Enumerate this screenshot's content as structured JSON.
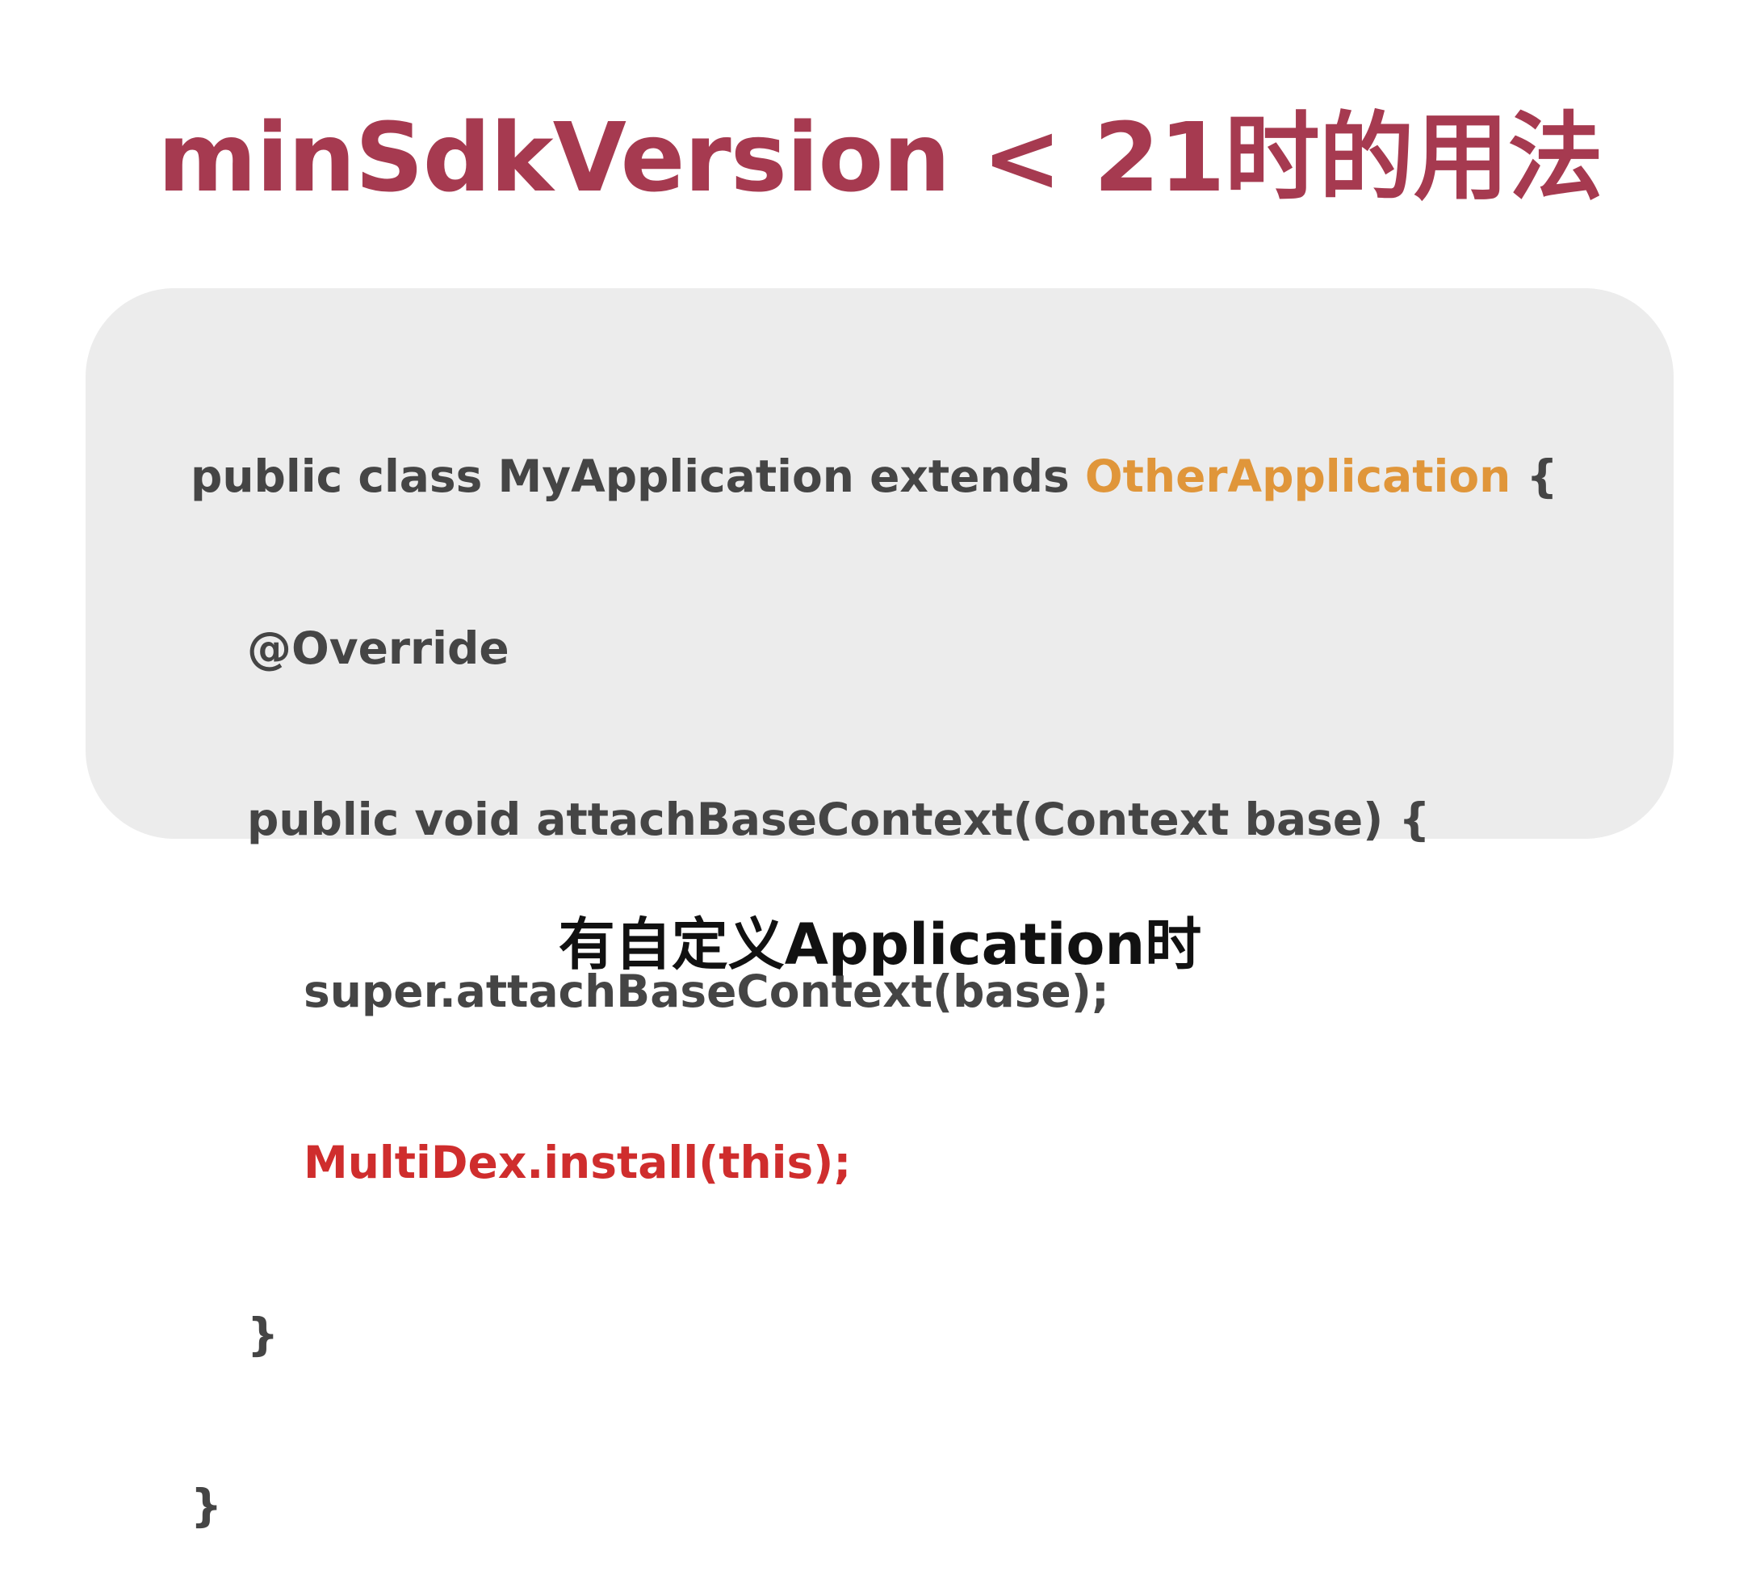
{
  "title": "minSdkVersion < 21时的用法",
  "code": {
    "line1_prefix": "public class MyApplication extends ",
    "line1_parent": "OtherApplication",
    "line1_suffix": " {",
    "line2": "@Override",
    "line3": "public void attachBaseContext(Context base) {",
    "line4": "super.attachBaseContext(base);",
    "line5": "MultiDex.install(this);",
    "line6": "}",
    "line7": "}"
  },
  "caption": "有自定义Application时",
  "colors": {
    "title": "#a63a50",
    "code_text": "#454545",
    "highlight_parent_class": "#e0963a",
    "highlight_install_call": "#cf2d2d",
    "card_background": "#ececec",
    "caption": "#111111"
  }
}
